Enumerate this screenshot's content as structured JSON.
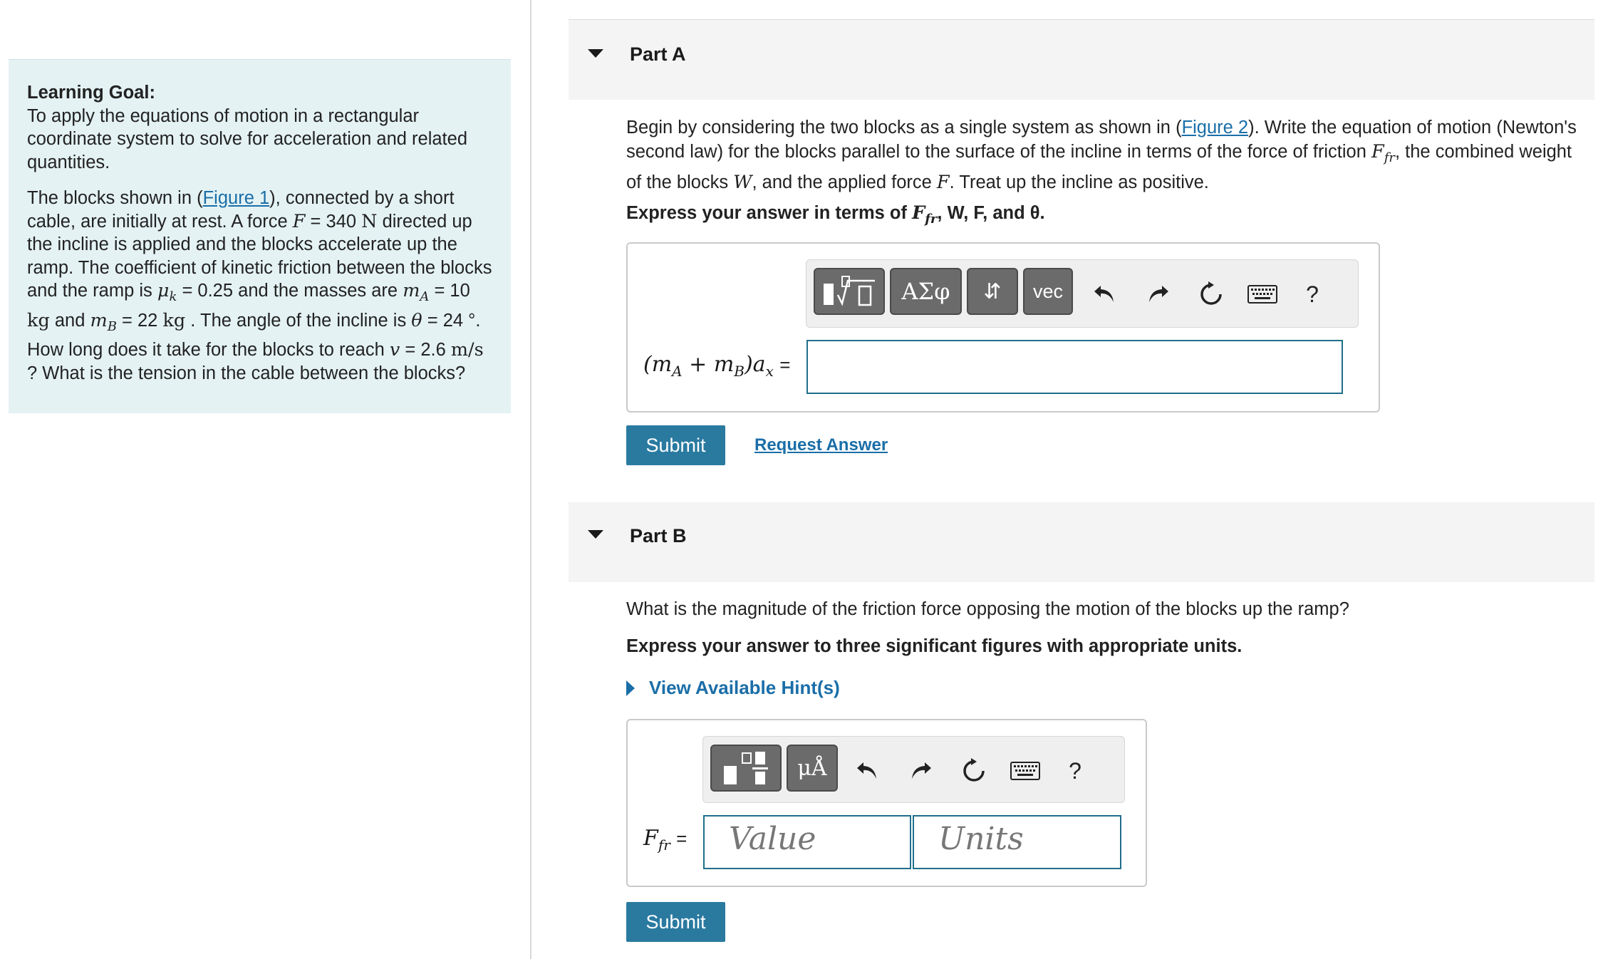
{
  "learning_goal": {
    "title": "Learning Goal:",
    "text": "To apply the equations of motion in a rectangular coordinate system to solve for acceleration and related quantities.",
    "problem": {
      "intro_pre": "The blocks shown in (",
      "figure_link": "Figure 1",
      "intro_post": "), connected by a short cable, are initially at rest. A force ",
      "F_sym": "F",
      "F_val": " = 340 ",
      "F_unit": "N",
      "t1": " directed up the incline is applied and the blocks accelerate up the ramp. The coefficient of kinetic friction between the blocks and the ramp is ",
      "mu_sym": "μ",
      "mu_sub": "k",
      "mu_val": " = 0.25 and the masses are ",
      "mA_sym": "m",
      "mA_sub": "A",
      "mA_val": " = 10 ",
      "mass_unit": "kg",
      "and": " and ",
      "mB_sym": "m",
      "mB_sub": "B",
      "mB_val": " = 22 ",
      "t2": " . The angle of the incline is ",
      "theta_sym": "θ",
      "theta_val": " = 24 °. How long does it take for the blocks to reach ",
      "v_sym": "v",
      "v_val": " = 2.6 ",
      "v_unit": "m/s",
      "t3": " ? What is the tension in the cable between the blocks?"
    }
  },
  "part_a": {
    "title": "Part A",
    "q_pre": "Begin by considering the two blocks as a single system as shown in (",
    "figure_link": "Figure 2",
    "q_mid": "). Write the equation of motion (Newton's second law) for the blocks parallel to the surface of the incline in terms of the force of friction ",
    "ffr_sym": "F",
    "ffr_sub": "fr",
    "q_mid2": ", the combined weight of the blocks ",
    "W_sym": "W",
    "q_mid3": ", and the applied force ",
    "F_sym": "F",
    "q_end": ". Treat up the incline as positive.",
    "express_pre": "Express your answer in terms of ",
    "express_vars": "F",
    "express_sub": "fr",
    "express_rest": ", W, F, and θ.",
    "toolbar": {
      "templates_glyph": "▮√□",
      "greek_label": "ΑΣφ",
      "arrows_label": "⇵",
      "vec_label": "vec",
      "help_label": "?"
    },
    "lhs": "(m",
    "lhs_sub_a": "A",
    "lhs_plus": " + m",
    "lhs_sub_b": "B",
    "lhs_a": ")a",
    "lhs_sub_x": "x",
    "eq": "=",
    "answer_value": "",
    "submit_label": "Submit",
    "request_answer_label": "Request Answer"
  },
  "part_b": {
    "title": "Part B",
    "question": "What is the magnitude of the friction force opposing the motion of the blocks up the ramp?",
    "express": "Express your answer to three significant figures with appropriate units.",
    "hint_label": "View Available Hint(s)",
    "toolbar": {
      "units_label": "μÅ",
      "help_label": "?"
    },
    "lhs_sym": "F",
    "lhs_sub": "fr",
    "eq": "=",
    "value_placeholder": "Value",
    "units_placeholder": "Units",
    "submit_label": "Submit"
  },
  "colors": {
    "accent": "#2a7aa0",
    "goal_bg": "#e4f2f4",
    "link": "#1a6ea8",
    "toolbar_btn": "#6b6b6b"
  }
}
